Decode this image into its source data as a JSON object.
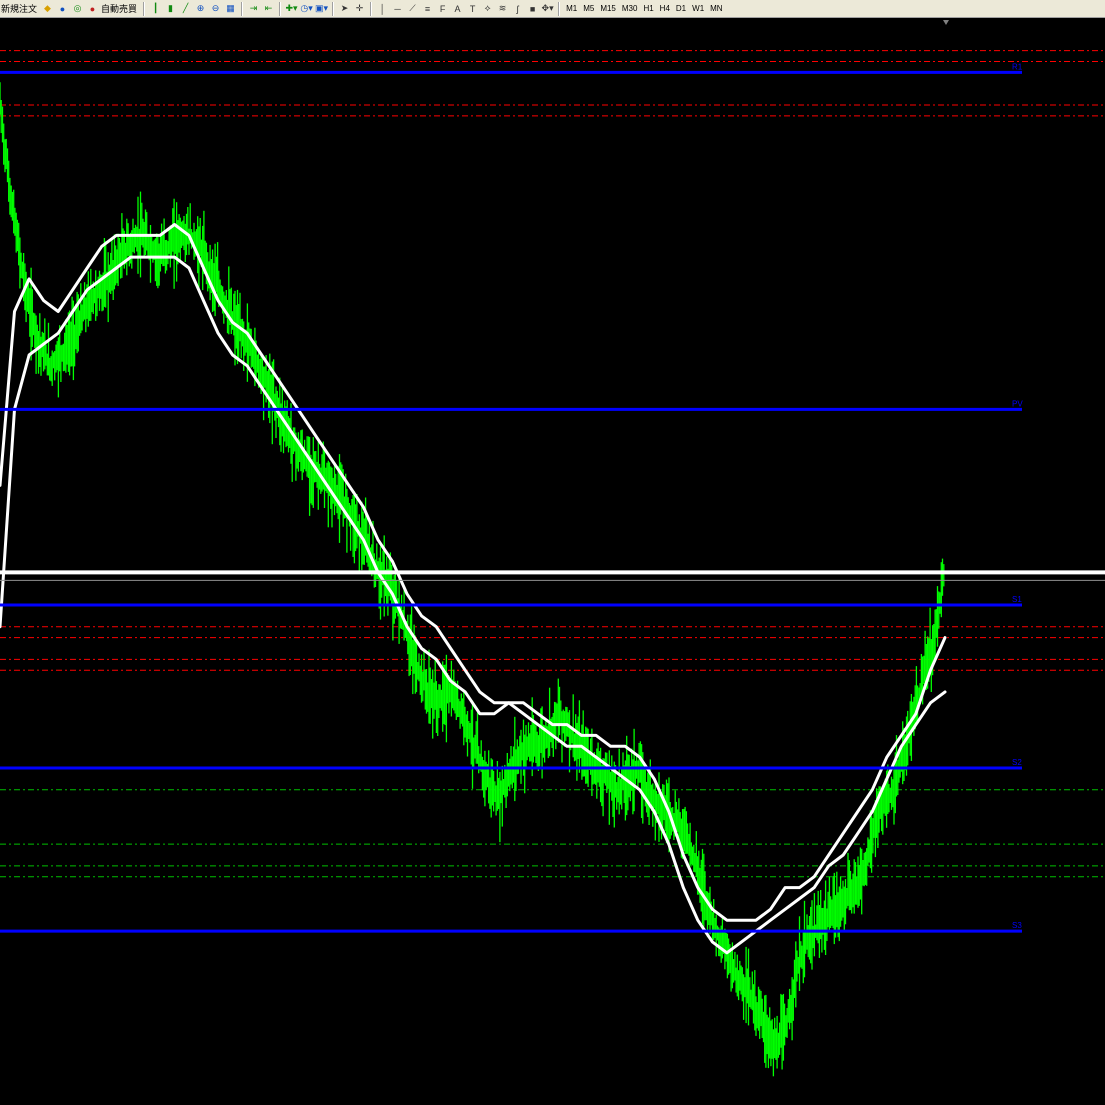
{
  "toolbar": {
    "new_order_label": "新規注文",
    "auto_trade_label": "自動売買",
    "timeframes": [
      "M1",
      "M5",
      "M15",
      "M30",
      "H1",
      "H4",
      "D1",
      "W1",
      "MN"
    ],
    "icons": [
      "gold-diamond-icon",
      "profile-icon",
      "globe-icon",
      "auto-trade-icon",
      "bar-chart-icon",
      "candle-chart-icon",
      "line-chart-icon",
      "zoom-in-icon",
      "zoom-out-icon",
      "tile-windows-icon",
      "autoscroll-icon",
      "chart-shift-icon",
      "indicators-icon",
      "periods-icon",
      "templates-icon",
      "cursor-icon",
      "crosshair-icon",
      "vertical-line-icon",
      "horizontal-line-icon",
      "trendline-icon",
      "channel-icon",
      "fibonacci-icon",
      "text-icon",
      "text-label-icon",
      "gann-icon",
      "elliot-icon",
      "cycle-icon",
      "rectangle-icon",
      "arrows-icon"
    ]
  },
  "chart": {
    "background": "#000000",
    "candle_color": "#00ff00",
    "ma_color": "#ffffff",
    "level_color": "#0000ff",
    "red_dash_color": "#ff0000",
    "green_dash_color": "#00c000",
    "level_labels": [
      "R1",
      "PV",
      "S1",
      "S2",
      "S3"
    ]
  },
  "chart_data": {
    "type": "line",
    "title": "",
    "xlabel": "",
    "ylabel": "",
    "price_series": {
      "name": "",
      "values": [
        0.08,
        0.16,
        0.22,
        0.27,
        0.3,
        0.32,
        0.31,
        0.3,
        0.28,
        0.26,
        0.25,
        0.24,
        0.22,
        0.21,
        0.2,
        0.21,
        0.22,
        0.21,
        0.2,
        0.2,
        0.21,
        0.23,
        0.25,
        0.27,
        0.29,
        0.3,
        0.32,
        0.34,
        0.36,
        0.38,
        0.4,
        0.41,
        0.42,
        0.43,
        0.44,
        0.45,
        0.47,
        0.49,
        0.51,
        0.52,
        0.54,
        0.57,
        0.6,
        0.62,
        0.63,
        0.62,
        0.63,
        0.65,
        0.68,
        0.7,
        0.72,
        0.7,
        0.68,
        0.67,
        0.67,
        0.66,
        0.64,
        0.65,
        0.67,
        0.68,
        0.69,
        0.7,
        0.71,
        0.7,
        0.69,
        0.71,
        0.72,
        0.73,
        0.74,
        0.75,
        0.78,
        0.81,
        0.84,
        0.86,
        0.88,
        0.89,
        0.91,
        0.93,
        0.95,
        0.93,
        0.88,
        0.85,
        0.84,
        0.83,
        0.82,
        0.81,
        0.8,
        0.78,
        0.74,
        0.72,
        0.71,
        0.67,
        0.64,
        0.6,
        0.57,
        0.5
      ]
    },
    "ma_fast": {
      "name": "",
      "values": [
        0.43,
        0.27,
        0.24,
        0.26,
        0.27,
        0.25,
        0.23,
        0.21,
        0.2,
        0.2,
        0.2,
        0.2,
        0.19,
        0.2,
        0.23,
        0.26,
        0.28,
        0.29,
        0.31,
        0.33,
        0.35,
        0.37,
        0.39,
        0.41,
        0.43,
        0.45,
        0.48,
        0.5,
        0.53,
        0.55,
        0.56,
        0.58,
        0.6,
        0.62,
        0.63,
        0.63,
        0.63,
        0.64,
        0.65,
        0.65,
        0.66,
        0.66,
        0.67,
        0.67,
        0.68,
        0.7,
        0.73,
        0.77,
        0.8,
        0.82,
        0.83,
        0.83,
        0.83,
        0.82,
        0.8,
        0.8,
        0.79,
        0.77,
        0.75,
        0.73,
        0.71,
        0.68,
        0.66,
        0.64,
        0.6,
        0.57
      ]
    },
    "ma_slow": {
      "name": "",
      "values": [
        0.56,
        0.36,
        0.31,
        0.3,
        0.29,
        0.27,
        0.25,
        0.24,
        0.23,
        0.22,
        0.22,
        0.22,
        0.22,
        0.23,
        0.26,
        0.29,
        0.31,
        0.32,
        0.34,
        0.36,
        0.38,
        0.4,
        0.42,
        0.44,
        0.46,
        0.48,
        0.51,
        0.53,
        0.56,
        0.58,
        0.59,
        0.61,
        0.62,
        0.64,
        0.64,
        0.63,
        0.64,
        0.65,
        0.66,
        0.67,
        0.67,
        0.68,
        0.69,
        0.7,
        0.71,
        0.73,
        0.76,
        0.8,
        0.83,
        0.85,
        0.86,
        0.85,
        0.84,
        0.83,
        0.82,
        0.81,
        0.8,
        0.78,
        0.77,
        0.75,
        0.73,
        0.7,
        0.67,
        0.65,
        0.63,
        0.62
      ]
    },
    "horizontal_levels": [
      0.05,
      0.36,
      0.54,
      0.69,
      0.84
    ],
    "current_price_level": 0.51,
    "red_dashed_levels": [
      0.03,
      0.04,
      0.08,
      0.09,
      0.56,
      0.57,
      0.59,
      0.6
    ],
    "green_dashed_levels": [
      0.71,
      0.76,
      0.78,
      0.79
    ],
    "ylim": [
      0,
      1
    ],
    "grid": false
  }
}
